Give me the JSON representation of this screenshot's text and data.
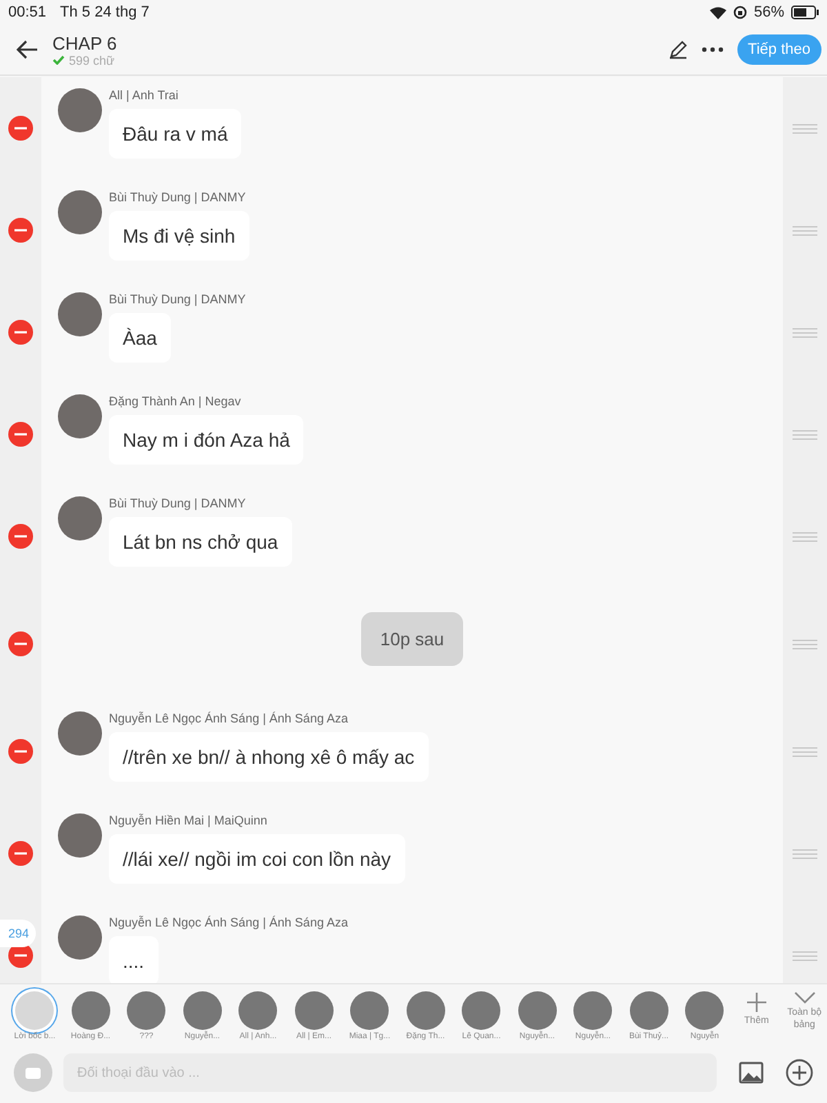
{
  "status_bar": {
    "time": "00:51",
    "date": "Th 5 24 thg 7",
    "battery": "56%"
  },
  "header": {
    "title": "CHAP 6",
    "word_count": "599 chữ",
    "next_button": "Tiếp theo"
  },
  "rows": [
    {
      "kind": "message",
      "speaker": "All | Anh Trai",
      "text": "Đâu ra v má"
    },
    {
      "kind": "message",
      "speaker": "Bùi Thuỳ Dung | DANMY",
      "text": "Ms đi vệ sinh"
    },
    {
      "kind": "message",
      "speaker": "Bùi Thuỳ Dung | DANMY",
      "text": "Àaa"
    },
    {
      "kind": "message",
      "speaker": "Đặng Thành An | Negav",
      "text": "Nay m i đón Aza hả"
    },
    {
      "kind": "message",
      "speaker": "Bùi Thuỳ Dung | DANMY",
      "text": "Lát bn ns chở qua"
    },
    {
      "kind": "narration",
      "text": "10p sau"
    },
    {
      "kind": "message",
      "speaker": "Nguyễn Lê Ngọc Ánh Sáng | Ánh Sáng Aza",
      "text": "//trên xe bn// à nhong xê ô mấy ac"
    },
    {
      "kind": "message",
      "speaker": "Nguyễn Hiền Mai | MaiQuinn",
      "text": "//lái xe// ngồi im coi con lồn này"
    },
    {
      "kind": "message",
      "speaker": "Nguyễn Lê Ngọc Ánh Sáng | Ánh Sáng Aza",
      "text": "...."
    }
  ],
  "line_count_badge": "294",
  "characters": [
    {
      "label": "Lời bốc b...",
      "selected": true
    },
    {
      "label": "Hoàng Đ...",
      "selected": false
    },
    {
      "label": "???",
      "selected": false
    },
    {
      "label": "Nguyễn...",
      "selected": false
    },
    {
      "label": "All | Anh...",
      "selected": false
    },
    {
      "label": "All | Em...",
      "selected": false
    },
    {
      "label": "Miaa | Tg...",
      "selected": false
    },
    {
      "label": "Đặng Th...",
      "selected": false
    },
    {
      "label": "Lê Quan...",
      "selected": false
    },
    {
      "label": "Nguyễn...",
      "selected": false
    },
    {
      "label": "Nguyễn...",
      "selected": false
    },
    {
      "label": "Bùi Thuỷ...",
      "selected": false
    },
    {
      "label": "Nguyễn",
      "selected": false
    }
  ],
  "add_character": "Thêm",
  "all_characters": "Toàn bộ bảng",
  "input": {
    "placeholder": "Đối thoại đầu vào ..."
  }
}
